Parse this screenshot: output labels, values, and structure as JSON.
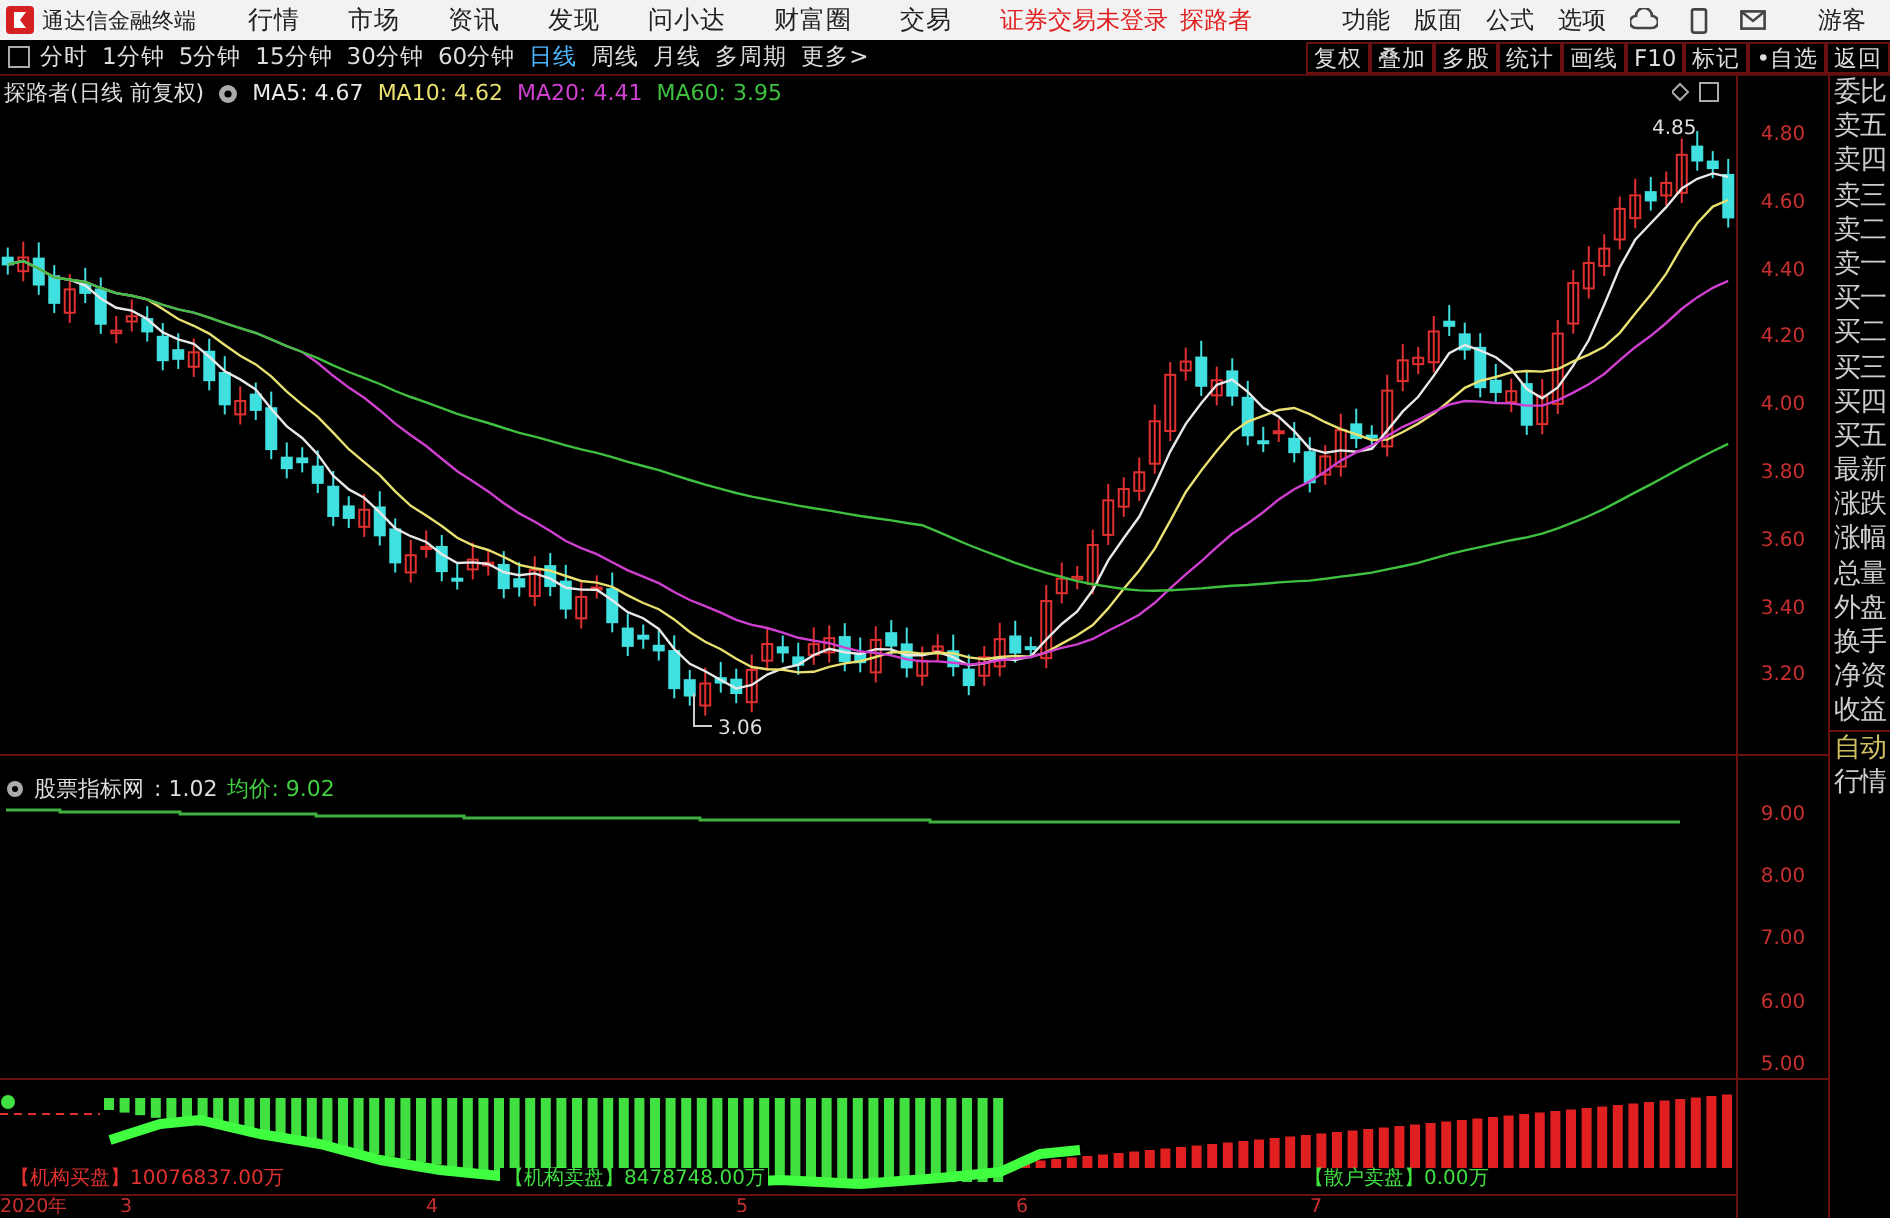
{
  "app": {
    "name": "通达信金融终端"
  },
  "menu": [
    "行情",
    "市场",
    "资讯",
    "发现",
    "问小达",
    "财富圈",
    "交易"
  ],
  "login_status": "证券交易未登录",
  "account": "探路者",
  "top_links": [
    "功能",
    "版面",
    "公式",
    "选项"
  ],
  "guest": "游客",
  "periods": [
    {
      "label": "分时",
      "selected": false
    },
    {
      "label": "1分钟",
      "selected": false
    },
    {
      "label": "5分钟",
      "selected": false
    },
    {
      "label": "15分钟",
      "selected": false
    },
    {
      "label": "30分钟",
      "selected": false
    },
    {
      "label": "60分钟",
      "selected": false
    },
    {
      "label": "日线",
      "selected": true
    },
    {
      "label": "周线",
      "selected": false
    },
    {
      "label": "月线",
      "selected": false
    },
    {
      "label": "多周期",
      "selected": false
    },
    {
      "label": "更多>",
      "selected": false
    }
  ],
  "tools": [
    "复权",
    "叠加",
    "多股",
    "统计",
    "画线",
    "F10",
    "标记",
    "•自选",
    "返回"
  ],
  "chart": {
    "title": "探路者(日线 前复权)",
    "ma": [
      {
        "label": "MA5: 4.67",
        "color": "#e8e8e8"
      },
      {
        "label": "MA10: 4.62",
        "color": "#e8e070"
      },
      {
        "label": "MA20: 4.41",
        "color": "#d040d0"
      },
      {
        "label": "MA60: 3.95",
        "color": "#40c040"
      }
    ],
    "yticks": [
      "4.80",
      "4.60",
      "4.40",
      "4.20",
      "4.00",
      "3.80",
      "3.60",
      "3.40",
      "3.20"
    ],
    "high_label": "4.85",
    "low_label": "3.06"
  },
  "indicator": {
    "name": "股票指标网",
    "value": ": 1.02",
    "avg": "均价: 9.02",
    "yticks": [
      "9.00",
      "8.00",
      "7.00",
      "6.00",
      "5.00"
    ]
  },
  "flow": {
    "labels": [
      {
        "text": "【机构买盘】10076837.00万",
        "color": "#e03030"
      },
      {
        "text": "【机构卖盘】8478748.00万",
        "color": "#40e040"
      },
      {
        "text": "【散户卖盘】0.00万",
        "color": "#40e040"
      }
    ]
  },
  "x_axis": [
    "2020年",
    "3",
    "4",
    "5",
    "6",
    "7"
  ],
  "quote_panel": {
    "items": [
      "委比",
      "卖五",
      "卖四",
      "卖三",
      "卖二",
      "卖一",
      "买一",
      "买二",
      "买三",
      "买四",
      "买五",
      "最新",
      "涨跌",
      "涨幅",
      "总量",
      "外盘",
      "换手",
      "净资",
      "收益"
    ],
    "modes": [
      {
        "label": "自动",
        "selected": true
      },
      {
        "label": "行情",
        "selected": false
      }
    ]
  }
}
